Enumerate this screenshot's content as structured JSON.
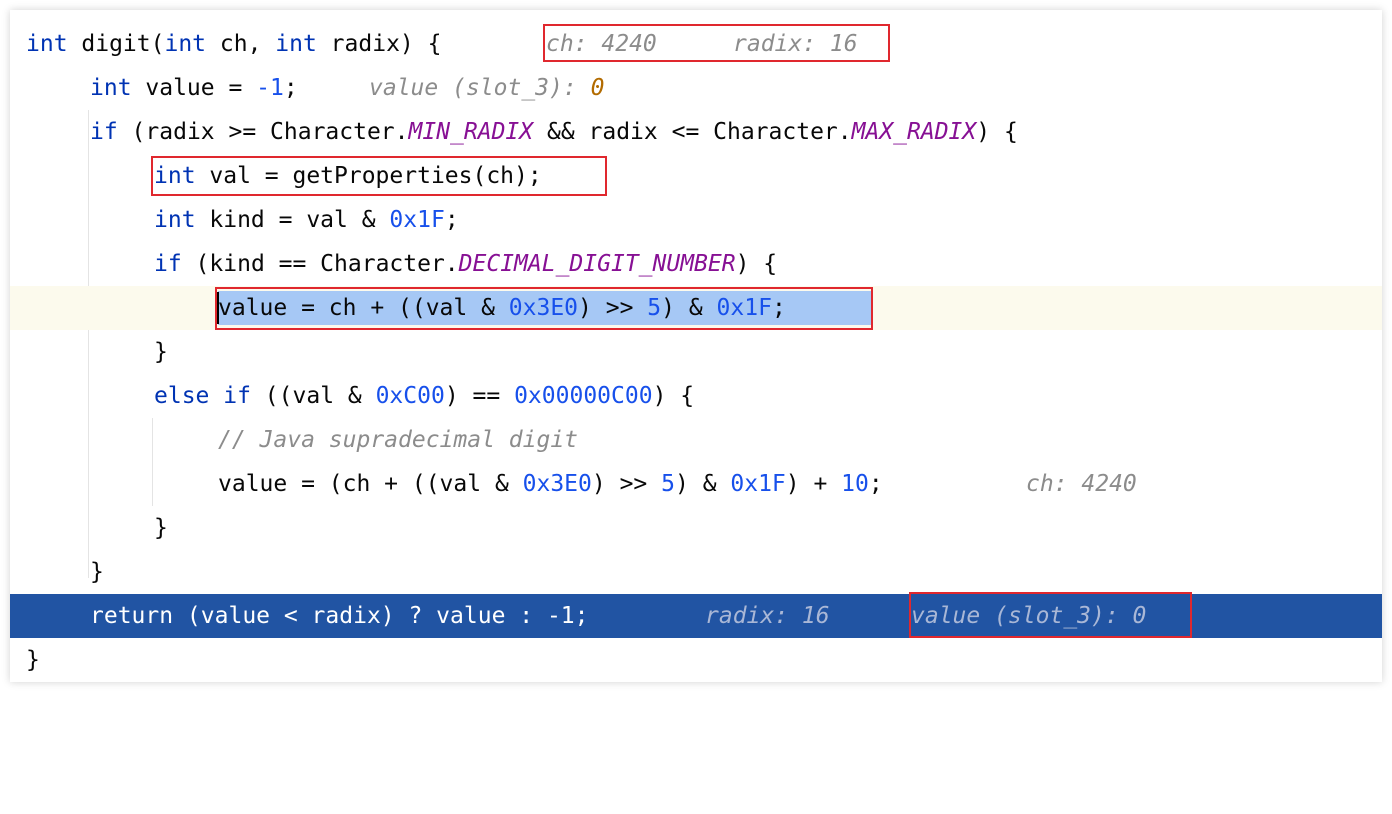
{
  "editor": {
    "lines": [
      {
        "tokens": [
          {
            "text": "int",
            "cls": "kw"
          },
          {
            "text": " digit(",
            "cls": ""
          },
          {
            "text": "int",
            "cls": "kw"
          },
          {
            "text": " ch, ",
            "cls": ""
          },
          {
            "text": "int",
            "cls": "kw"
          },
          {
            "text": " radix) {",
            "cls": ""
          }
        ]
      },
      {
        "tokens": [
          {
            "text": "int",
            "cls": "kw"
          },
          {
            "text": " value = ",
            "cls": ""
          },
          {
            "text": "-1",
            "cls": "num"
          },
          {
            "text": ";",
            "cls": ""
          }
        ]
      },
      {
        "tokens": [
          {
            "text": "if",
            "cls": "kw"
          },
          {
            "text": " (radix >= Character.",
            "cls": ""
          },
          {
            "text": "MIN_RADIX",
            "cls": "const"
          },
          {
            "text": " && radix <= Character.",
            "cls": ""
          },
          {
            "text": "MAX_RADIX",
            "cls": "const"
          },
          {
            "text": ") {",
            "cls": ""
          }
        ]
      },
      {
        "tokens": [
          {
            "text": "int",
            "cls": "kw"
          },
          {
            "text": " val = getProperties(ch);",
            "cls": ""
          }
        ]
      },
      {
        "tokens": [
          {
            "text": "int",
            "cls": "kw"
          },
          {
            "text": " kind = val & ",
            "cls": ""
          },
          {
            "text": "0x1F",
            "cls": "num"
          },
          {
            "text": ";",
            "cls": ""
          }
        ]
      },
      {
        "tokens": [
          {
            "text": "if",
            "cls": "kw"
          },
          {
            "text": " (kind == Character.",
            "cls": ""
          },
          {
            "text": "DECIMAL_DIGIT_NUMBER",
            "cls": "const"
          },
          {
            "text": ") {",
            "cls": ""
          }
        ]
      },
      {
        "tokens": [
          {
            "text": "value = ch + ((val & ",
            "cls": ""
          },
          {
            "text": "0x3E0",
            "cls": "num"
          },
          {
            "text": ") >> ",
            "cls": ""
          },
          {
            "text": "5",
            "cls": "num"
          },
          {
            "text": ") & ",
            "cls": ""
          },
          {
            "text": "0x1F",
            "cls": "num"
          },
          {
            "text": ";",
            "cls": ""
          }
        ]
      },
      {
        "tokens": [
          {
            "text": "}",
            "cls": ""
          }
        ]
      },
      {
        "tokens": [
          {
            "text": "else",
            "cls": "kw"
          },
          {
            "text": " ",
            "cls": ""
          },
          {
            "text": "if",
            "cls": "kw"
          },
          {
            "text": " ((val & ",
            "cls": ""
          },
          {
            "text": "0xC00",
            "cls": "num"
          },
          {
            "text": ") == ",
            "cls": ""
          },
          {
            "text": "0x00000C00",
            "cls": "num"
          },
          {
            "text": ") {",
            "cls": ""
          }
        ]
      },
      {
        "tokens": [
          {
            "text": "// Java supradecimal digit",
            "cls": "comment"
          }
        ]
      },
      {
        "tokens": [
          {
            "text": "value = (ch + ((val & ",
            "cls": ""
          },
          {
            "text": "0x3E0",
            "cls": "num"
          },
          {
            "text": ") >> ",
            "cls": ""
          },
          {
            "text": "5",
            "cls": "num"
          },
          {
            "text": ") & ",
            "cls": ""
          },
          {
            "text": "0x1F",
            "cls": "num"
          },
          {
            "text": ") + ",
            "cls": ""
          },
          {
            "text": "10",
            "cls": "num"
          },
          {
            "text": ";",
            "cls": ""
          }
        ]
      },
      {
        "tokens": [
          {
            "text": "}",
            "cls": ""
          }
        ]
      },
      {
        "tokens": [
          {
            "text": "}",
            "cls": ""
          }
        ]
      },
      {
        "tokens": [
          {
            "text": "return (value < radix) ? value : -1;",
            "cls": ""
          }
        ]
      },
      {
        "tokens": [
          {
            "text": "}",
            "cls": ""
          }
        ]
      }
    ]
  },
  "hints": {
    "line1_ch": "ch: 4240",
    "line1_radix": "radix: 16",
    "line2_label": "value (slot_3): ",
    "line2_value": "0",
    "line11_ch": "ch: 4240",
    "line14_radix": "radix: 16",
    "line14_value": "value (slot_3): 0"
  },
  "state": {
    "caret_line": 7,
    "execution_line": 14
  },
  "colors": {
    "keyword": "#0033b3",
    "number": "#1750eb",
    "constant": "#871094",
    "comment": "#8c8c8c",
    "inlay_hint": "#8c8c8c",
    "inlay_hint_value": "#b26b00",
    "execution_line_bg": "#2154a3",
    "caret_line_bg": "#fcfaed",
    "selection_bg": "#a6c8f5",
    "annotation_box": "#e0282e"
  }
}
